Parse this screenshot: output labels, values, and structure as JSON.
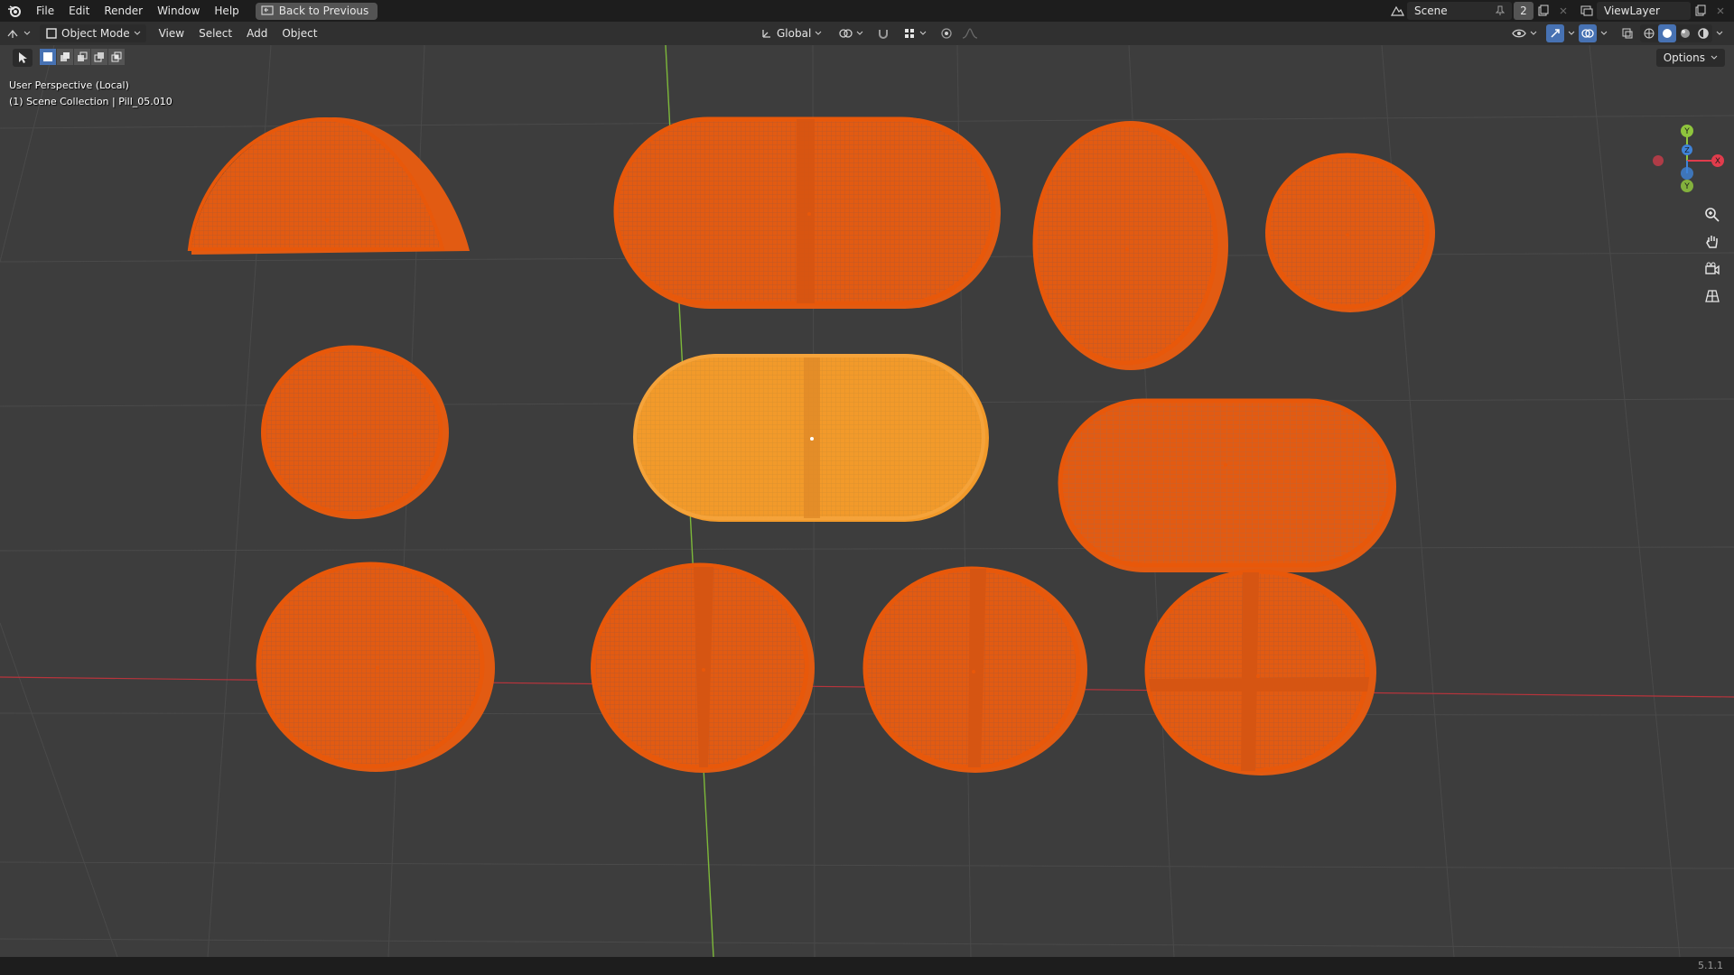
{
  "topbar": {
    "menus": [
      "File",
      "Edit",
      "Render",
      "Window",
      "Help"
    ],
    "back_button": "Back to Previous",
    "scene_name": "Scene",
    "scene_users": "2",
    "view_layer": "ViewLayer"
  },
  "header": {
    "mode": "Object Mode",
    "menus": [
      "View",
      "Select",
      "Add",
      "Object"
    ],
    "transform_orientation": "Global"
  },
  "toolrow": {
    "options_label": "Options"
  },
  "viewport": {
    "perspective_label": "User Perspective (Local)",
    "collection_label": "(1) Scene Collection | Pill_05.010"
  },
  "gizmo": {
    "x_label": "X",
    "y_label": "Y",
    "z_label": "Z",
    "x_color": "#e03c4c",
    "y_color": "#8fc53d",
    "z_color": "#3f83d8"
  },
  "colors": {
    "selected_outline": "#e8580a",
    "active_object": "#f29a2a",
    "grid": "#4a4a4a",
    "x_axis": "#b8343c",
    "y_axis": "#7db83a"
  },
  "statusbar": {
    "version": "5.1.1"
  }
}
